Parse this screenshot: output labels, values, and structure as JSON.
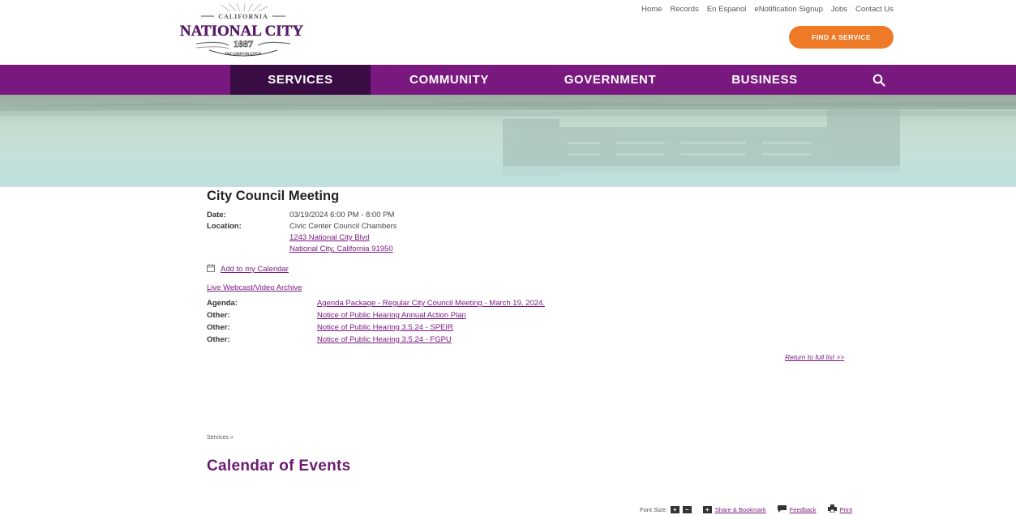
{
  "header": {
    "logo": {
      "top_text": "CALIFORNIA",
      "main_text": "NATIONAL CITY",
      "year": "1887",
      "bottom_text": "INCORPORATED"
    },
    "top_links": [
      "Home",
      "Records",
      "En Espanol",
      "eNotification Signup",
      "Jobs",
      "Contact Us"
    ],
    "find_button": "FIND A SERVICE"
  },
  "nav": {
    "items": [
      "SERVICES",
      "COMMUNITY",
      "GOVERNMENT",
      "BUSINESS"
    ],
    "search_icon": "search-icon",
    "active_color": "#3a0c44",
    "bar_color": "#79187f"
  },
  "event": {
    "title": "City Council Meeting",
    "date_label": "Date:",
    "date_value": "03/19/2024 6:00 PM - 8:00 PM",
    "location_label": "Location:",
    "location_name": "Civic Center Council Chambers",
    "address_line1": "1243 National City Blvd",
    "address_line2": "National City, California 91950",
    "add_calendar": "Add to my Calendar",
    "webcast": "Live Webcast/Video Archive",
    "documents": [
      {
        "label": "Agenda:",
        "title": "Agenda Package - Regular City Council Meeting - March 19, 2024."
      },
      {
        "label": "Other:",
        "title": "Notice of Public Hearing Annual Action Plan"
      },
      {
        "label": "Other:",
        "title": "Notice of Public Hearing 3.5.24 - SPEIR"
      },
      {
        "label": "Other:",
        "title": "Notice of Public Hearing 3.5.24 - FGPU"
      }
    ],
    "return_link": "Return to full list >>"
  },
  "breadcrumb": "Services »",
  "page_title": "Calendar of Events",
  "tools": {
    "font_size_label": "Font Size:",
    "share": "Share & Bookmark",
    "feedback": "Feedback",
    "print": "Print"
  }
}
